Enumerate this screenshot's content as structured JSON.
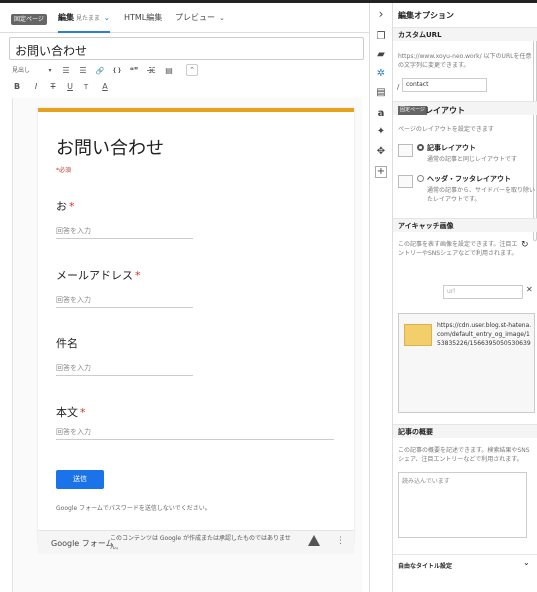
{
  "editor": {
    "fixed_page_badge": "固定ページ",
    "tabs": [
      {
        "label": "編集",
        "sub": "見たまま",
        "chevron": "⌄"
      },
      {
        "label": "HTML編集"
      },
      {
        "label": "プレビュー",
        "chevron": "⌄"
      }
    ],
    "title_value": "お問い合わせ",
    "toolbar_row1": [
      "見出し",
      "☰",
      "☰",
      "🔗",
      "❴❵",
      "❝❞",
      "⇥",
      "☷",
      "▤",
      "⌃"
    ],
    "toolbar_row2": [
      "B",
      "I",
      "T",
      "U",
      "T",
      "A"
    ]
  },
  "form": {
    "title": "お問い合わせ",
    "required_note": "*必須",
    "questions": [
      {
        "label": "お",
        "required": "*",
        "placeholder": "回答を入力"
      },
      {
        "label": "メールアドレス",
        "required": "*",
        "placeholder": "回答を入力"
      },
      {
        "label": "件名",
        "required": "",
        "placeholder": "回答を入力"
      },
      {
        "label": "本文",
        "required": "*",
        "placeholder": "回答を入力"
      }
    ],
    "submit_label": "送信",
    "password_note": "Google フォームでパスワードを送信しないでください。",
    "footer_brand": "Google フォーム",
    "footer_disclaimer": "このコンテンツは Google が作成または承認したものではありません。"
  },
  "icons": [
    "chevron-right-icon",
    "pages-icon",
    "folder-icon",
    "gear-icon",
    "document-icon",
    "amazon-icon",
    "twitter-icon",
    "pinwheel-icon",
    "plus-icon"
  ],
  "options": {
    "title": "編集オプション",
    "custom_url": {
      "title": "カスタムURL",
      "desc": "https://www.xoyu-neo.work/ 以下のURLを任意の文字列に変更できます。",
      "prefix": "/",
      "value": "contact"
    },
    "layout": {
      "badge": "固定ページ",
      "title": "レイアウト",
      "desc": "ページのレイアウトを設定できます",
      "options": [
        {
          "label": "記事レイアウト",
          "desc": "通常の記事と同じレイアウトです"
        },
        {
          "label": "ヘッダ・フッタレイアウト",
          "desc": "通常の記事から、サイドバーを取り除いたレイアウトです。"
        }
      ]
    },
    "eyecatch": {
      "title": "アイキャッチ画像",
      "desc": "この記事を表す画像を設定できます。注目エントリーやSNSシェアなどで利用されます。",
      "search_placeholder": "url",
      "image_url": "https://cdn.user.blog.st-hatena.com/default_entry_og_image/153835226/1566395050530639"
    },
    "summary": {
      "title": "記事の概要",
      "desc": "この記事の概要を記述できます。検索結果やSNSシェア、注目エントリーなどで利用されます。",
      "placeholder": "読み込んでいます"
    },
    "expand": {
      "label": "自由なタイトル設定"
    }
  },
  "colors": {
    "accent": "#1a73e8",
    "form_top": "#e6a21e",
    "required": "#d93025"
  }
}
